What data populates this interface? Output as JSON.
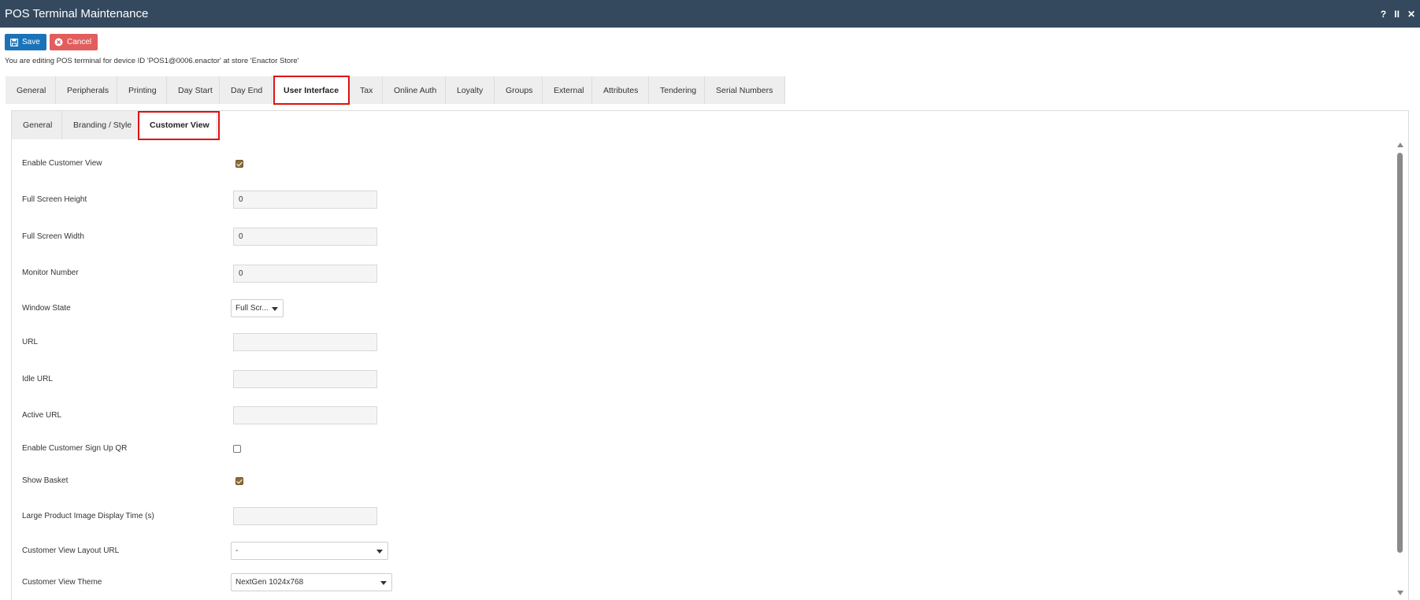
{
  "window": {
    "title": "POS Terminal Maintenance",
    "controls": {
      "help": "?",
      "pause": "II",
      "close": "✕"
    }
  },
  "toolbar": {
    "save_label": "Save",
    "cancel_label": "Cancel"
  },
  "info_text": "You are editing POS terminal for device ID 'POS1@0006.enactor' at store 'Enactor Store'",
  "main_tabs": [
    "General",
    "Peripherals",
    "Printing",
    "Day Start",
    "Day End",
    "User Interface",
    "Tax",
    "Online Auth",
    "Loyalty",
    "Groups",
    "External",
    "Attributes",
    "Tendering",
    "Serial Numbers"
  ],
  "active_main_tab": "User Interface",
  "sub_tabs": [
    "General",
    "Branding / Style",
    "Customer View"
  ],
  "active_sub_tab": "Customer View",
  "form": {
    "enable_customer_view": {
      "label": "Enable Customer View",
      "checked": true
    },
    "full_screen_height": {
      "label": "Full Screen Height",
      "value": "0"
    },
    "full_screen_width": {
      "label": "Full Screen Width",
      "value": "0"
    },
    "monitor_number": {
      "label": "Monitor Number",
      "value": "0"
    },
    "window_state": {
      "label": "Window State",
      "value": "Full Scr..."
    },
    "url": {
      "label": "URL",
      "value": ""
    },
    "idle_url": {
      "label": "Idle URL",
      "value": ""
    },
    "active_url": {
      "label": "Active URL",
      "value": ""
    },
    "enable_sign_up_qr": {
      "label": "Enable Customer Sign Up QR",
      "checked": false
    },
    "show_basket": {
      "label": "Show Basket",
      "checked": true
    },
    "large_image_time": {
      "label": "Large Product Image Display Time (s)",
      "value": ""
    },
    "layout_url": {
      "label": "Customer View Layout URL",
      "value": "-"
    },
    "theme": {
      "label": "Customer View Theme",
      "value": "NextGen 1024x768"
    }
  },
  "colors": {
    "titlebar": "#34495e",
    "save": "#1a73b8",
    "cancel": "#e25d5d",
    "highlight": "#e01010",
    "checkbox_checked": "#8c6d3a"
  }
}
